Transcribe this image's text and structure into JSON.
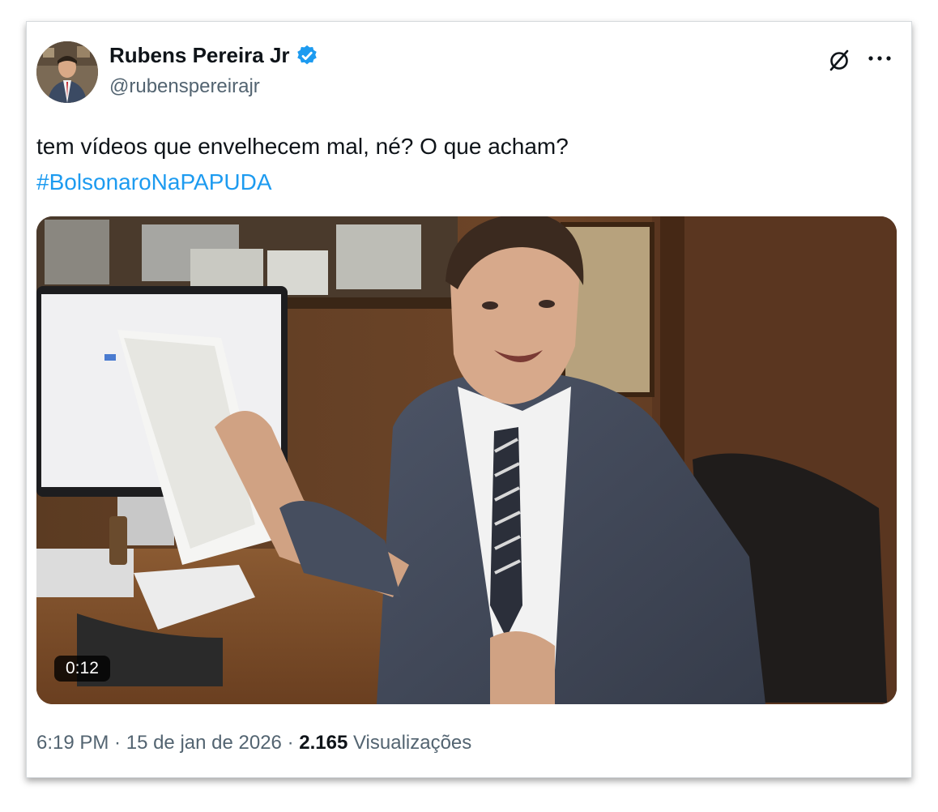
{
  "tweet": {
    "author_name": "Rubens Pereira Jr",
    "handle": "@rubenspereirajr",
    "text": "tem vídeos que envelhecem mal, né? O que acham?",
    "hashtag": "#BolsonaroNaPAPUDA",
    "video_duration": "0:12",
    "time": "6:19 PM",
    "separator": " · ",
    "date": "15 de jan de 2026",
    "views_count": "2.165",
    "views_label": "Visualizações"
  },
  "icons": {
    "verified": "verified-badge-icon",
    "grok": "grok-icon",
    "more": "more-icon"
  },
  "colors": {
    "link": "#1d9bf0",
    "verified": "#1d9bf0",
    "text": "#0f1419",
    "muted": "#536471"
  }
}
